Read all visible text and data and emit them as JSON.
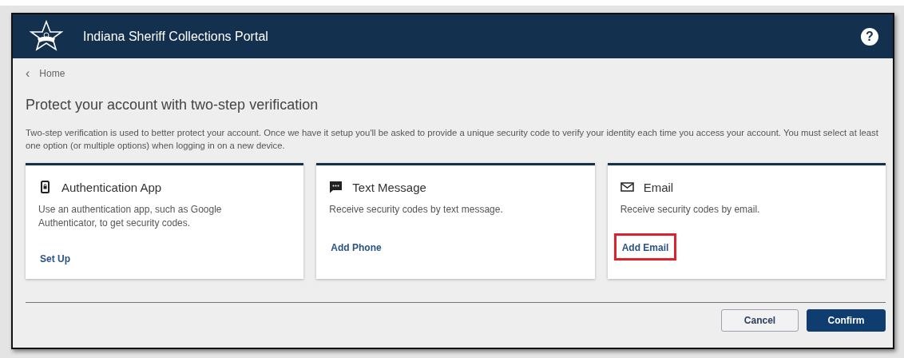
{
  "header": {
    "title": "Indiana Sheriff Collections Portal",
    "help_icon": "?"
  },
  "breadcrumb": {
    "back": "‹",
    "label": "Home"
  },
  "heading": "Protect your account with two-step verification",
  "description": "Two-step verification is used to better protect your account. Once we have it setup you'll be asked to provide a unique security code to verify your identity each time you access your account. You must select at least one option (or multiple options) when logging in on a new device.",
  "options": [
    {
      "kind": "app",
      "title": "Authentication App",
      "text": "Use an authentication app, such as Google Authenticator, to get security codes.",
      "link": "Set Up",
      "highlighted": false
    },
    {
      "kind": "sms",
      "title": "Text Message",
      "text": "Receive security codes by text message.",
      "link": "Add Phone",
      "highlighted": false
    },
    {
      "kind": "email",
      "title": "Email",
      "text": "Receive security codes by email.",
      "link": "Add Email",
      "highlighted": true
    }
  ],
  "buttons": [
    {
      "label": "Cancel",
      "kind": "secondary"
    },
    {
      "label": "Confirm",
      "kind": "primary"
    }
  ]
}
